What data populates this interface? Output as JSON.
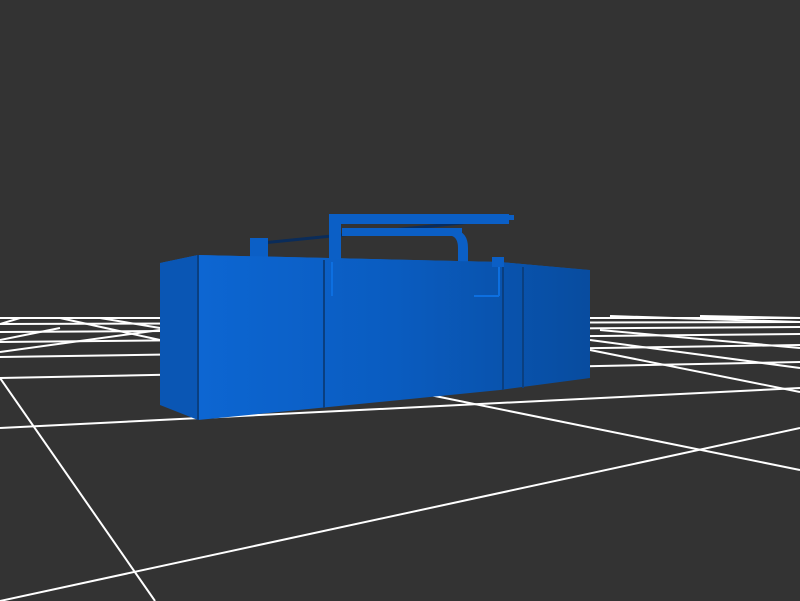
{
  "viewer": {
    "background_color": "#333333",
    "grid_color": "#ffffff",
    "model_color": "#0b5fc6",
    "model_shade_color": "#084a9c",
    "model_edge_color": "#0a3f80",
    "model": "boombox"
  }
}
